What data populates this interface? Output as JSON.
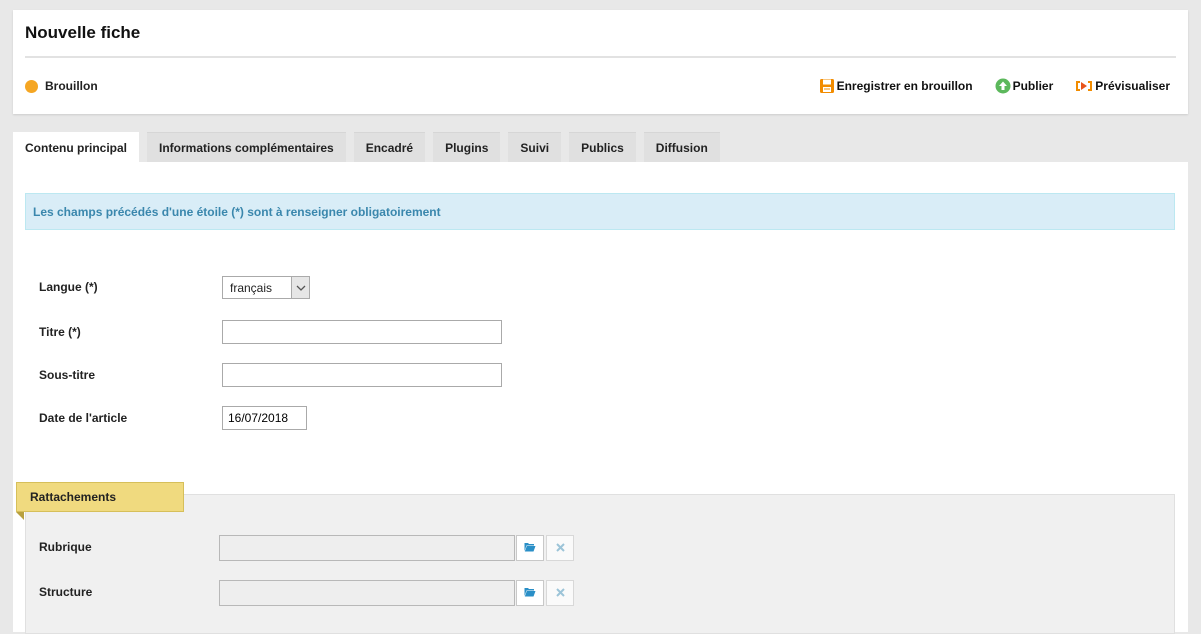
{
  "header": {
    "title": "Nouvelle fiche",
    "status": {
      "label": "Brouillon",
      "color": "#f5a623"
    },
    "actions": [
      {
        "label": "Enregistrer en brouillon",
        "icon": "save-icon",
        "color": "#f28c00"
      },
      {
        "label": "Publier",
        "icon": "publish-icon",
        "color": "#5cb85c"
      },
      {
        "label": "Prévisualiser",
        "icon": "preview-icon",
        "color": "#f28c00"
      }
    ]
  },
  "tabs": [
    {
      "label": "Contenu principal",
      "active": true
    },
    {
      "label": "Informations complémentaires",
      "active": false
    },
    {
      "label": "Encadré",
      "active": false
    },
    {
      "label": "Plugins",
      "active": false
    },
    {
      "label": "Suivi",
      "active": false
    },
    {
      "label": "Publics",
      "active": false
    },
    {
      "label": "Diffusion",
      "active": false
    }
  ],
  "info": {
    "message": "Les champs précédés d'une étoile (*) sont à renseigner obligatoirement"
  },
  "form": {
    "langue": {
      "label": "Langue  (*)",
      "value": "français"
    },
    "titre": {
      "label": "Titre (*)",
      "value": ""
    },
    "sous_titre": {
      "label": "Sous-titre",
      "value": ""
    },
    "date": {
      "label": "Date de l'article",
      "value": "16/07/2018"
    }
  },
  "rattachements": {
    "title": "Rattachements",
    "rubrique": {
      "label": "Rubrique",
      "value": ""
    },
    "structure": {
      "label": "Structure",
      "value": ""
    }
  },
  "colors": {
    "info_bg": "#d9edf7",
    "info_text": "#3a87ad",
    "ribbon": "#f0da7f",
    "folder_icon": "#2a8fc7"
  }
}
